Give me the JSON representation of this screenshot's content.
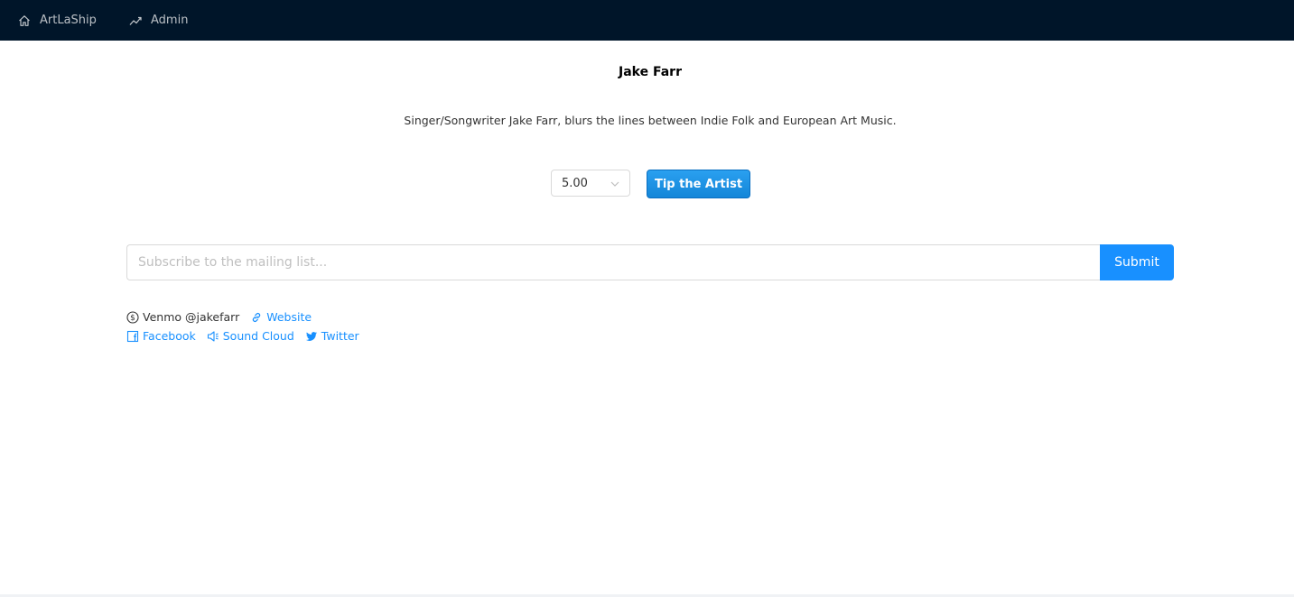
{
  "nav": {
    "home_label": "ArtLaShip",
    "admin_label": "Admin"
  },
  "artist": {
    "name": "Jake Farr",
    "description": "Singer/Songwriter Jake Farr, blurs the lines between Indie Folk and European Art Music."
  },
  "tip": {
    "amount": "5.00",
    "button_label": "Tip the Artist"
  },
  "subscribe": {
    "placeholder": "Subscribe to the mailing list...",
    "submit_label": "Submit"
  },
  "links": {
    "venmo": "Venmo @jakefarr",
    "website": "Website",
    "facebook": "Facebook",
    "soundcloud": "Sound Cloud",
    "twitter": "Twitter"
  },
  "colors": {
    "topbar": "#001529",
    "accent": "#1890ff"
  }
}
